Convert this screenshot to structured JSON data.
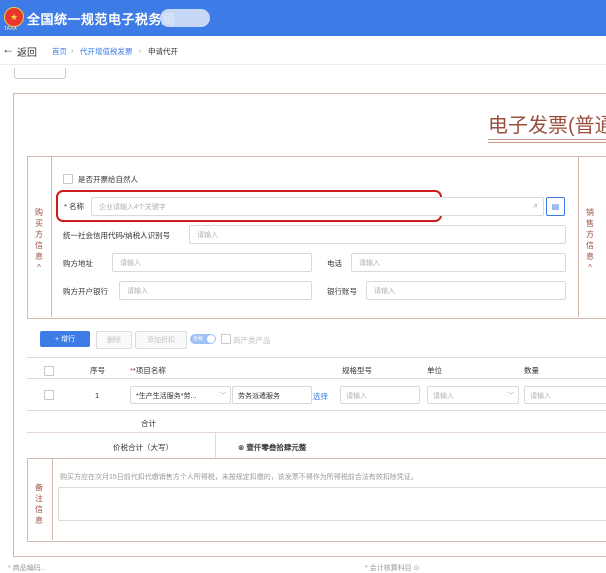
{
  "header": {
    "emblem_caption": "TAXA",
    "title": "全国统一规范电子税务局"
  },
  "nav": {
    "back_label": "返回",
    "breadcrumb": [
      "首页",
      "代开增值税发票",
      "申请代开"
    ],
    "sep": "›"
  },
  "invoice": {
    "title": "电子发票(普通",
    "buyer_side_label": [
      "购",
      "买",
      "方",
      "信",
      "息",
      "^"
    ],
    "seller_side_label": [
      "销",
      "售",
      "方",
      "信",
      "息",
      "^"
    ],
    "natural_person_label": "是否开票给自然人",
    "name_label": "* 名称",
    "name_placeholder": "企业请输入4个关键字",
    "credit_code_label": "统一社会信用代码/纳税人识别号",
    "credit_code_placeholder": "请输入",
    "address_label": "购方地址",
    "address_placeholder": "请输入",
    "phone_label": "电话",
    "phone_placeholder": "请输入",
    "bank_label": "购方开户银行",
    "bank_placeholder": "请输入",
    "account_label": "银行账号",
    "account_placeholder": "请输入"
  },
  "toolbar": {
    "add_row": "+ 增行",
    "delete": "删除",
    "add_discount": "添加折扣",
    "toggle_label": "含税",
    "product_checkbox": "商产类产品"
  },
  "items_table": {
    "headers": {
      "seq": "序号",
      "name": "*项目名称",
      "spec": "规格型号",
      "unit": "单位",
      "qty": "数量"
    },
    "rows": [
      {
        "seq": "1",
        "category": "*生产生活服务*劳...",
        "name": "劳务派遣服务",
        "select_link": "选择",
        "spec_placeholder": "请输入",
        "unit_placeholder": "请输入",
        "qty_placeholder": "请输入"
      }
    ],
    "subtotal_label": "合计",
    "total_label": "价税合计（大写）",
    "total_value": "⊗ 壹仟零叁拾肆元整"
  },
  "remark": {
    "side_label": [
      "备",
      "注",
      "信",
      "息"
    ],
    "note": "购买方应在次月15日前代扣代缴销售方个人所得税，未按规定扣缴的，该发票不得作为所得税前合法有效扣除凭证。"
  },
  "footer": {
    "left": "* 商品编码...",
    "right": "* 会计核算科目 ⊙"
  },
  "colors": {
    "brand_blue": "#3d7ce6",
    "invoice_brown": "#9a4f3e",
    "highlight_red": "#cc1d1d"
  }
}
